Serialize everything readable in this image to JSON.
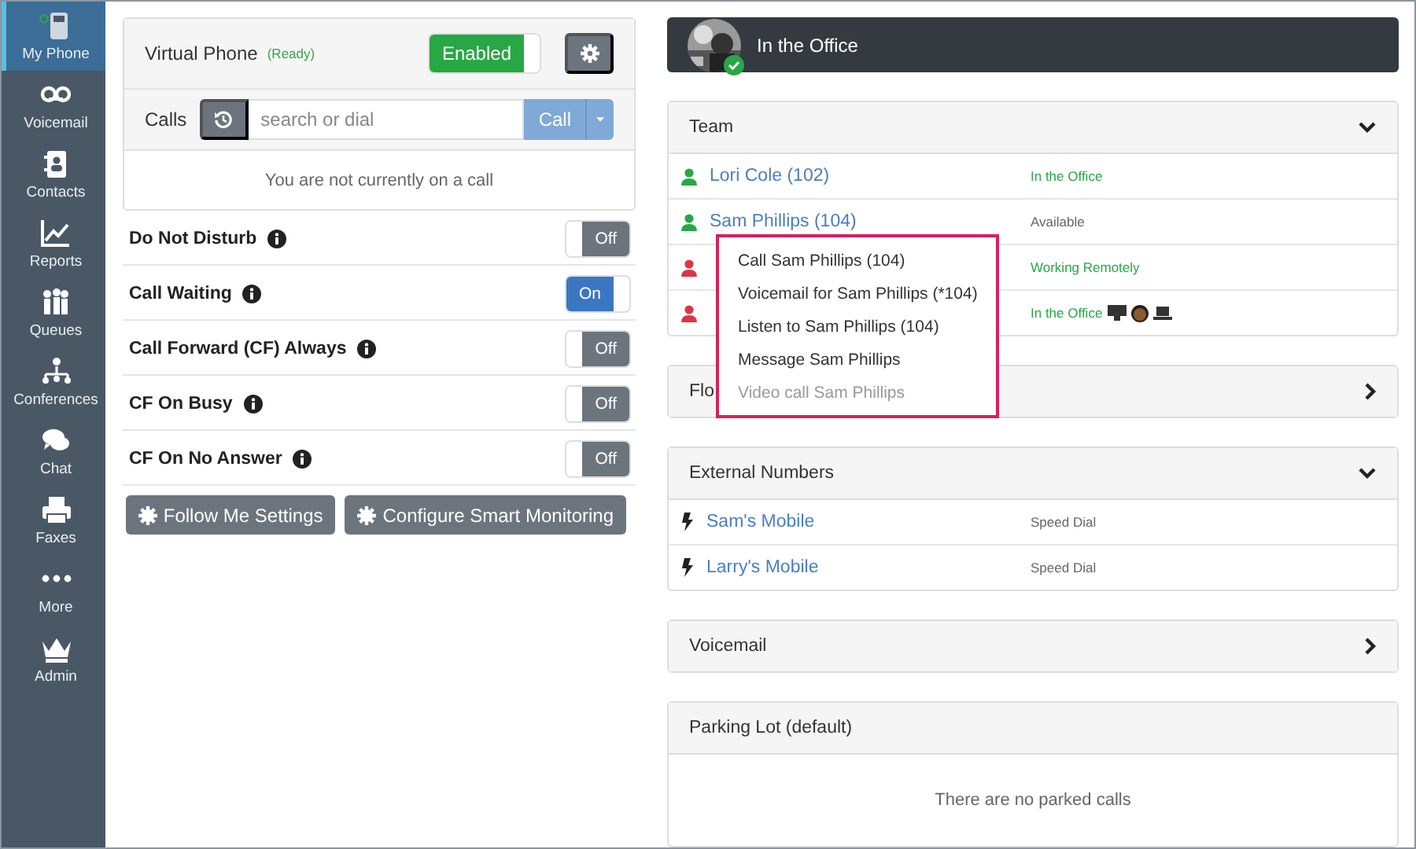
{
  "sidebar": {
    "items": [
      {
        "label": "My Phone",
        "selected": true
      },
      {
        "label": "Voicemail",
        "selected": false
      },
      {
        "label": "Contacts",
        "selected": false
      },
      {
        "label": "Reports",
        "selected": false
      },
      {
        "label": "Queues",
        "selected": false
      },
      {
        "label": "Conferences",
        "selected": false
      },
      {
        "label": "Chat",
        "selected": false
      },
      {
        "label": "Faxes",
        "selected": false
      },
      {
        "label": "More",
        "selected": false
      },
      {
        "label": "Admin",
        "selected": false
      }
    ]
  },
  "virtual_phone": {
    "label": "Virtual Phone",
    "status": "(Ready)",
    "toggle": {
      "label": "Enabled",
      "on": true
    }
  },
  "calls": {
    "label": "Calls",
    "search": {
      "placeholder": "search or dial"
    },
    "call_button": "Call",
    "message": "You are not currently on a call"
  },
  "settings": [
    {
      "label": "Do Not Disturb",
      "on": false,
      "text": "Off"
    },
    {
      "label": "Call Waiting",
      "on": true,
      "text": "On"
    },
    {
      "label": "Call Forward (CF) Always",
      "on": false,
      "text": "Off"
    },
    {
      "label": "CF On Busy",
      "on": false,
      "text": "Off"
    },
    {
      "label": "CF On No Answer",
      "on": false,
      "text": "Off"
    }
  ],
  "buttons": [
    "Follow Me Settings",
    "Configure Smart Monitoring"
  ],
  "presence": {
    "status": "In the Office"
  },
  "panels": [
    {
      "kind": "team",
      "title": "Team",
      "expanded": true,
      "rows": [
        {
          "name": "Lori Cole (102)",
          "status": "In the Office",
          "color": "#28a745",
          "status_highlight": true,
          "devices": false
        },
        {
          "name": "Sam Phillips (104)",
          "status": "Available",
          "color": "#28a745",
          "status_highlight": false,
          "devices": false
        },
        {
          "status": "Working Remotely",
          "color": "#dc3545",
          "status_highlight": true,
          "devices": false
        },
        {
          "status": "In the Office",
          "color": "#dc3545",
          "status_highlight": true,
          "devices": true
        }
      ]
    },
    {
      "kind": "plain",
      "title": "Flo",
      "expanded": false
    },
    {
      "kind": "external",
      "title": "External Numbers",
      "expanded": true,
      "rows": [
        {
          "name": "Sam's Mobile",
          "type": "Speed Dial"
        },
        {
          "name": "Larry's Mobile",
          "type": "Speed Dial"
        }
      ]
    },
    {
      "kind": "plain",
      "title": "Voicemail",
      "expanded": false
    },
    {
      "kind": "parking",
      "title": "Parking Lot (default)",
      "message": "There are no parked calls"
    }
  ],
  "context_menu": {
    "items": [
      {
        "label": "Call Sam Phillips (104)",
        "disabled": false
      },
      {
        "label": "Voicemail for Sam Phillips (*104)",
        "disabled": false
      },
      {
        "label": "Listen to Sam Phillips (104)",
        "disabled": false
      },
      {
        "label": "Message Sam Phillips",
        "disabled": false
      },
      {
        "label": "Video call Sam Phillips",
        "disabled": true
      }
    ]
  }
}
